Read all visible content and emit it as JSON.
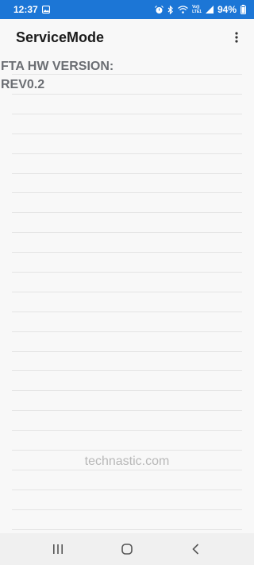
{
  "status_bar": {
    "time": "12:37",
    "battery": "94%",
    "network_top": "Vo))",
    "network_bottom": "LTE1"
  },
  "app_bar": {
    "title": "ServiceMode"
  },
  "content": {
    "line1": "FTA HW VERSION:",
    "line2": "REV0.2",
    "watermark": "technastic.com"
  },
  "colors": {
    "status_bar": "#1c76d6",
    "text": "#6b6e73"
  }
}
